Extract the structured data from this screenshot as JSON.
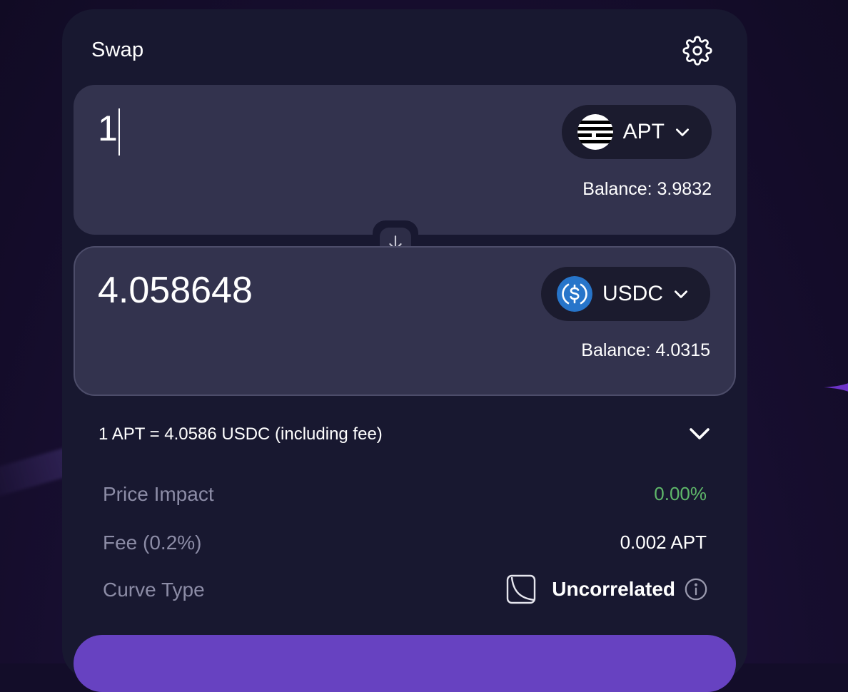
{
  "header": {
    "title": "Swap"
  },
  "from": {
    "amount": "1",
    "token": "APT",
    "balance": "Balance: 3.9832"
  },
  "to": {
    "amount": "4.058648",
    "token": "USDC",
    "balance": "Balance: 4.0315"
  },
  "rate": {
    "text": "1 APT = 4.0586 USDC (including fee)"
  },
  "details": {
    "price_impact_label": "Price Impact",
    "price_impact_value": "0.00%",
    "fee_label": "Fee (0.2%)",
    "fee_value": "0.002 APT",
    "curve_label": "Curve Type",
    "curve_value": "Uncorrelated"
  },
  "icons": {
    "settings": "gear-icon",
    "switch": "arrow-down-icon",
    "expand": "chevron-down-icon",
    "info": "info-icon",
    "curve": "curve-icon"
  },
  "colors": {
    "background": "#130d29",
    "card": "#181830",
    "panel": "#33334e",
    "accent": "#6742c1",
    "positive": "#5fb86a",
    "muted": "#8c8ca6"
  }
}
